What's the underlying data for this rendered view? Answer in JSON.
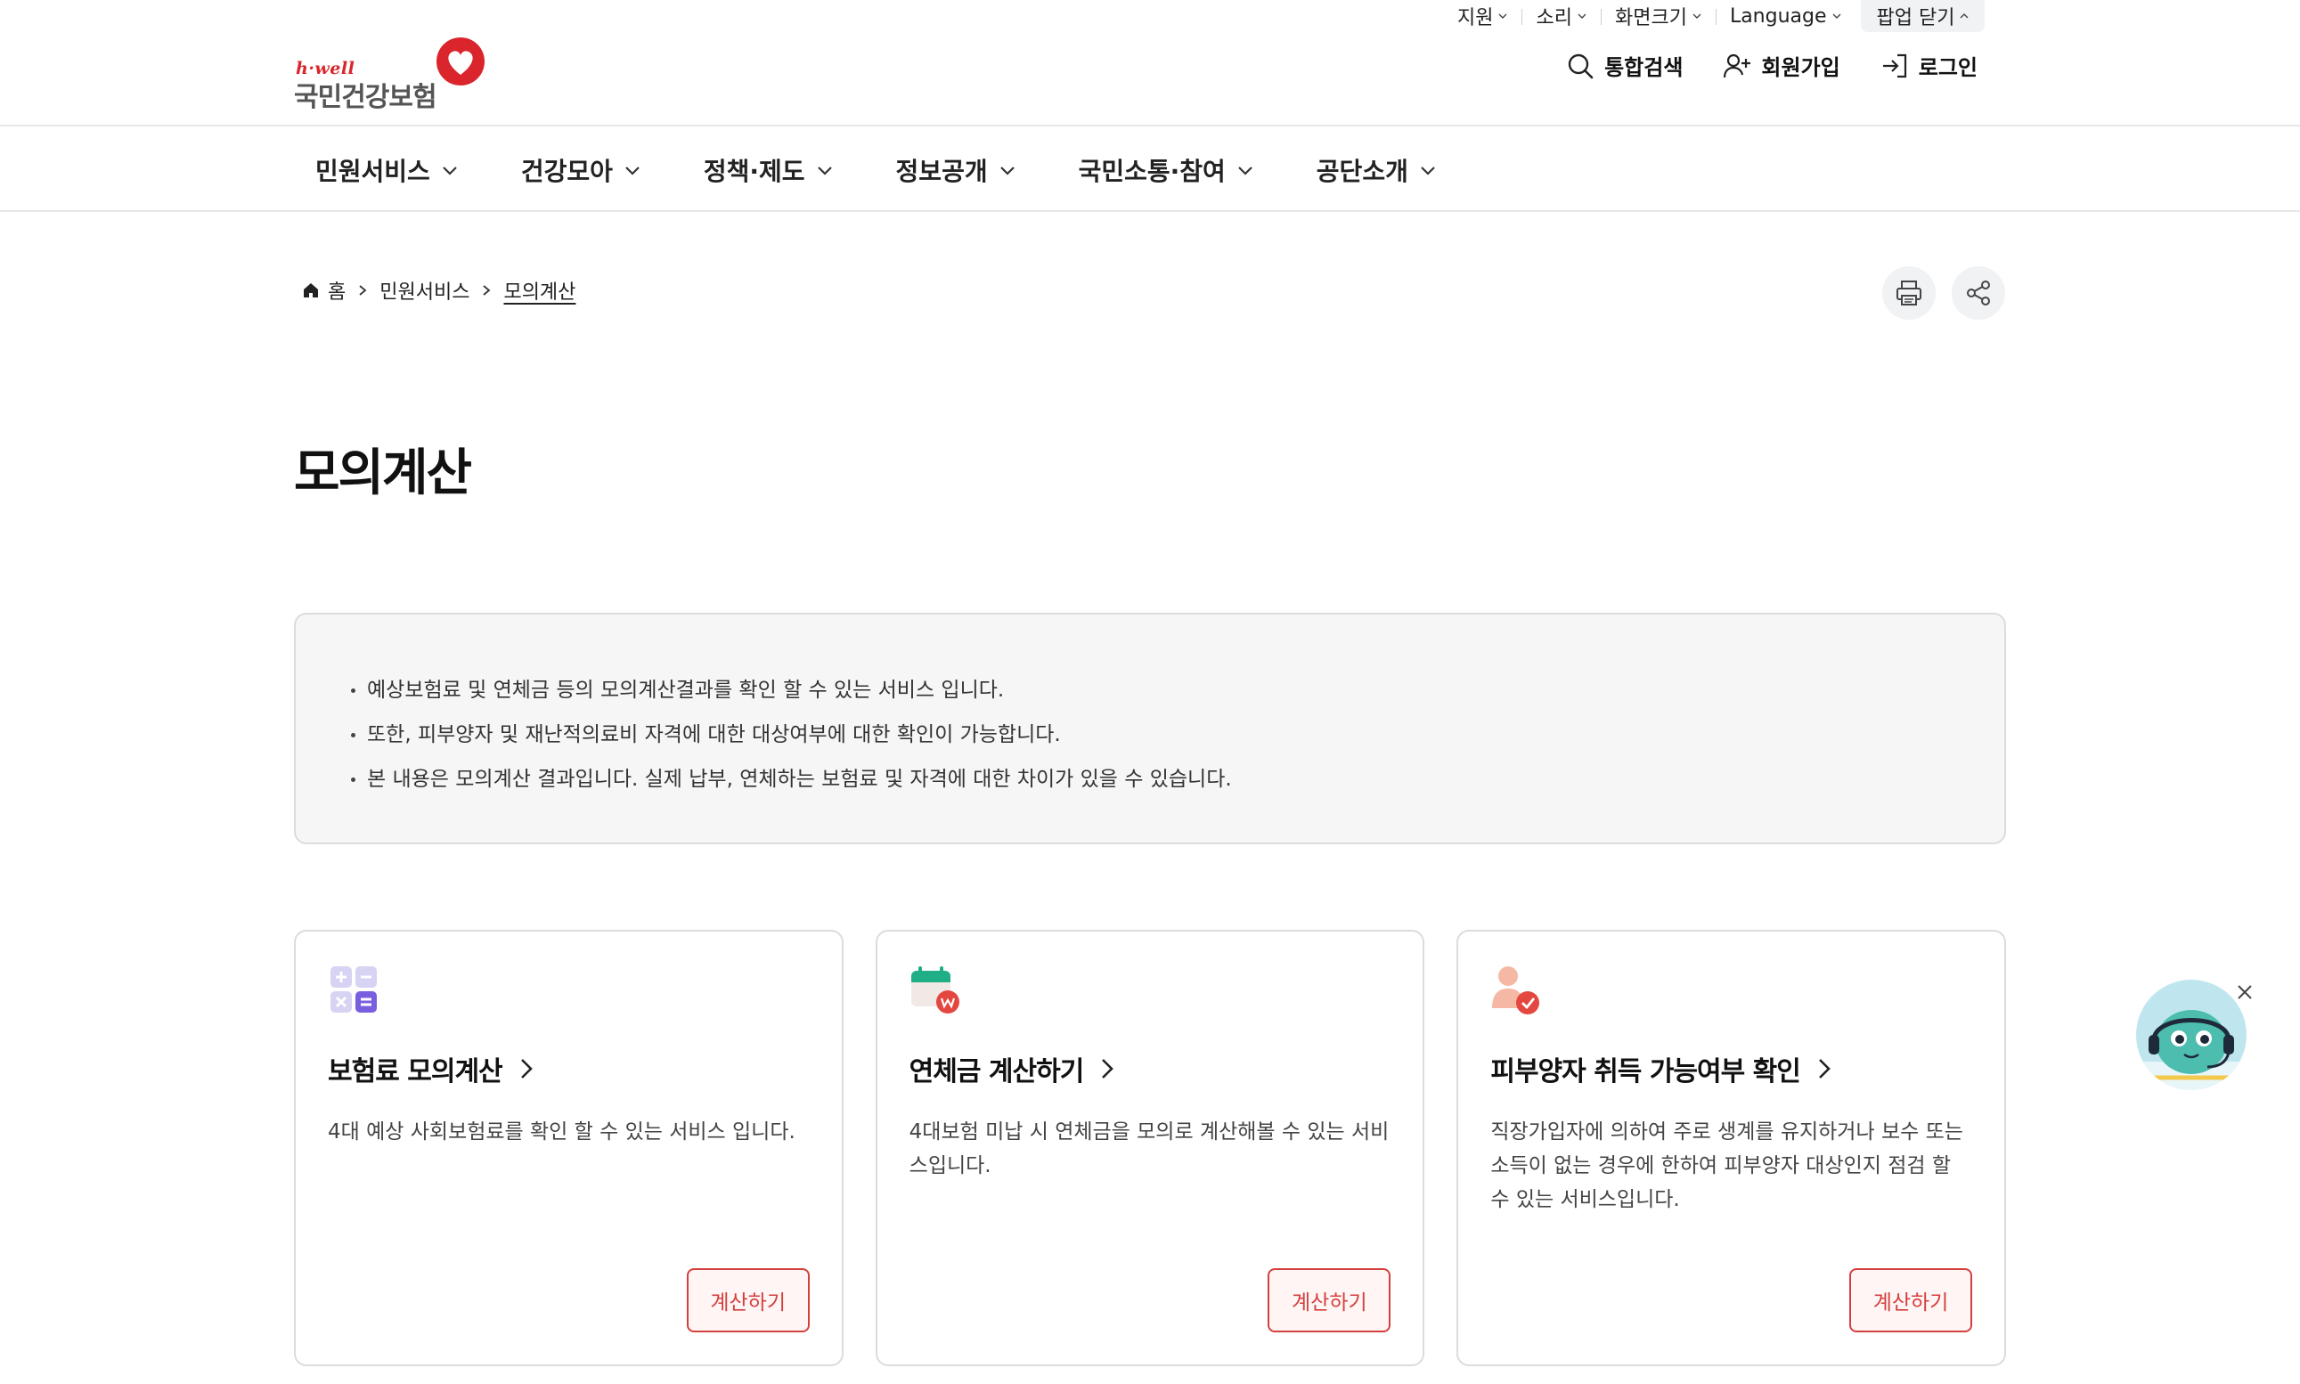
{
  "utility": {
    "items": [
      "지원",
      "소리",
      "화면크기",
      "Language"
    ],
    "popup_label": "팝업 닫기"
  },
  "logo": {
    "sub": "h·well",
    "name": "국민건강보험"
  },
  "header_actions": [
    {
      "label": "통합검색",
      "icon": "search-icon"
    },
    {
      "label": "회원가입",
      "icon": "user-add-icon"
    },
    {
      "label": "로그인",
      "icon": "login-icon"
    }
  ],
  "gnb": [
    "민원서비스",
    "건강모아",
    "정책·제도",
    "정보공개",
    "국민소통·참여",
    "공단소개"
  ],
  "breadcrumb": {
    "home": "홈",
    "level1": "민원서비스",
    "current": "모의계산"
  },
  "page_title": "모의계산",
  "info": [
    "예상보험료 및 연체금 등의 모의계산결과를 확인 할 수 있는 서비스 입니다.",
    "또한, 피부양자 및 재난적의료비 자격에 대한 대상여부에 대한 확인이 가능합니다.",
    "본 내용은 모의계산 결과입니다. 실제 납부, 연체하는 보험료 및 자격에 대한 차이가 있을 수 있습니다."
  ],
  "cards": [
    {
      "title": "보험료 모의계산",
      "desc": "4대 예상 사회보험료를 확인 할 수 있는 서비스 입니다.",
      "button": "계산하기",
      "icon": "calculator-icon"
    },
    {
      "title": "연체금 계산하기",
      "desc": "4대보험 미납 시 연체금을 모의로 계산해볼 수 있는 서비스입니다.",
      "button": "계산하기",
      "icon": "calendar-won-icon"
    },
    {
      "title": "피부양자 취득 가능여부 확인",
      "desc": "직장가입자에 의하여 주로 생계를 유지하거나 보수 또는 소득이 없는 경우에 한하여 피부양자 대상인지 점검 할 수 있는 서비스입니다.",
      "button": "계산하기",
      "icon": "person-check-icon"
    }
  ],
  "colors": {
    "accent": "#d4403e",
    "border": "#dcdcdc",
    "info_bg": "#f6f6f7"
  }
}
